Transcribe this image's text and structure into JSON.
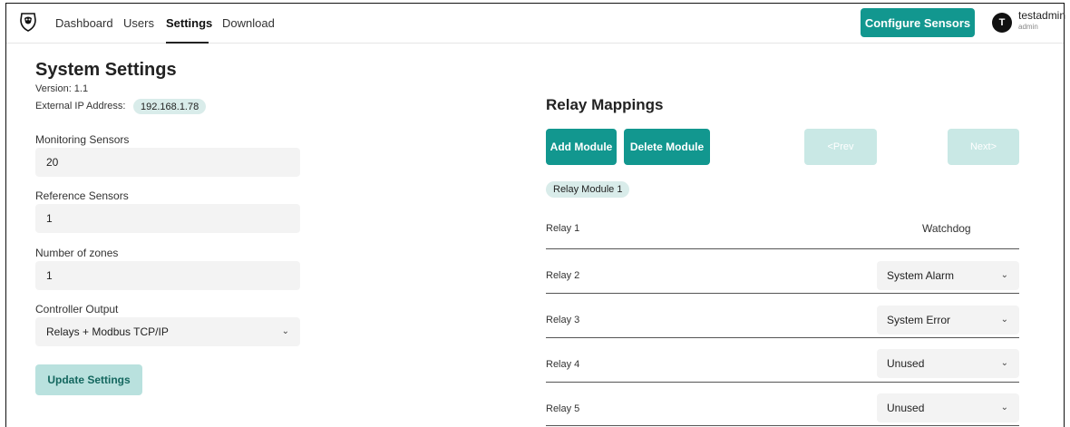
{
  "nav": {
    "items": [
      "Dashboard",
      "Users",
      "Settings",
      "Download"
    ],
    "active": "Settings"
  },
  "header": {
    "configure_label": "Configure Sensors",
    "avatar_initial": "T",
    "user_name": "testadmin",
    "user_role": "admin"
  },
  "settings": {
    "title": "System Settings",
    "version": "Version: 1.1",
    "ip_label": "External IP Address:",
    "ip_value": "192.168.1.78",
    "monitoring_label": "Monitoring Sensors",
    "monitoring_value": "20",
    "reference_label": "Reference Sensors",
    "reference_value": "1",
    "zones_label": "Number of zones",
    "zones_value": "1",
    "output_label": "Controller Output",
    "output_value": "Relays + Modbus TCP/IP",
    "update_label": "Update Settings"
  },
  "relays": {
    "title": "Relay Mappings",
    "add_label": "Add Module",
    "delete_label": "Delete Module",
    "prev_label": "<Prev",
    "next_label": "Next>",
    "module_label": "Relay Module 1",
    "rows": [
      {
        "label": "Relay 1",
        "value": "Watchdog"
      },
      {
        "label": "Relay 2",
        "value": "System Alarm"
      },
      {
        "label": "Relay 3",
        "value": "System Error"
      },
      {
        "label": "Relay 4",
        "value": "Unused"
      },
      {
        "label": "Relay 5",
        "value": "Unused"
      }
    ]
  },
  "colors": {
    "accent": "#12978f",
    "accent_light": "#b9e1de",
    "badge_bg": "#d9ecea"
  }
}
